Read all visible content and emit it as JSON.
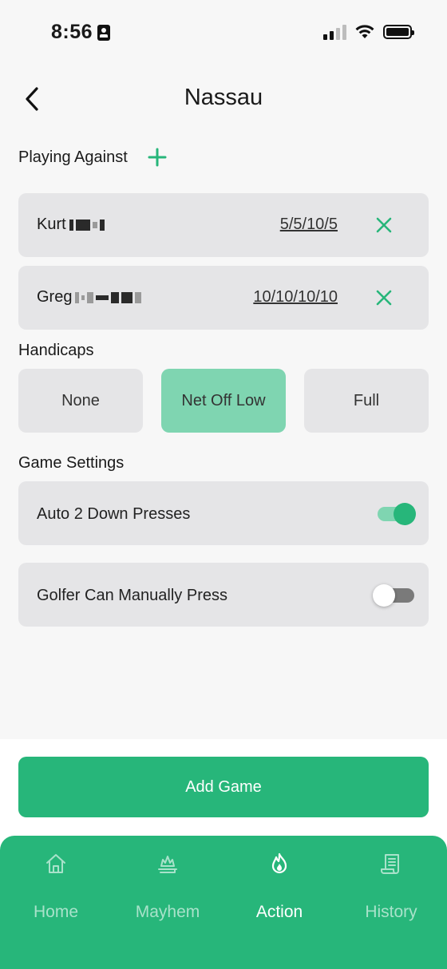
{
  "status": {
    "time": "8:56"
  },
  "header": {
    "title": "Nassau"
  },
  "playing_against": {
    "label": "Playing Against",
    "players": [
      {
        "name": "Kurt",
        "stakes": "5/5/10/5"
      },
      {
        "name": "Greg",
        "stakes": "10/10/10/10"
      }
    ]
  },
  "handicaps": {
    "label": "Handicaps",
    "options": [
      "None",
      "Net Off Low",
      "Full"
    ],
    "selected": "Net Off Low"
  },
  "game_settings": {
    "label": "Game Settings",
    "items": [
      {
        "label": "Auto 2 Down Presses",
        "enabled": true
      },
      {
        "label": "Golfer Can Manually Press",
        "enabled": false
      }
    ]
  },
  "actions": {
    "add_game": "Add Game"
  },
  "tabs": [
    {
      "label": "Home",
      "icon": "home-icon"
    },
    {
      "label": "Mayhem",
      "icon": "mayhem-icon"
    },
    {
      "label": "Action",
      "icon": "flame-icon"
    },
    {
      "label": "History",
      "icon": "scroll-icon"
    }
  ],
  "active_tab": "Action",
  "colors": {
    "accent": "#27b67a",
    "accent_light": "#7fd5b1",
    "card": "#e5e5e7",
    "background": "#f7f7f7"
  }
}
